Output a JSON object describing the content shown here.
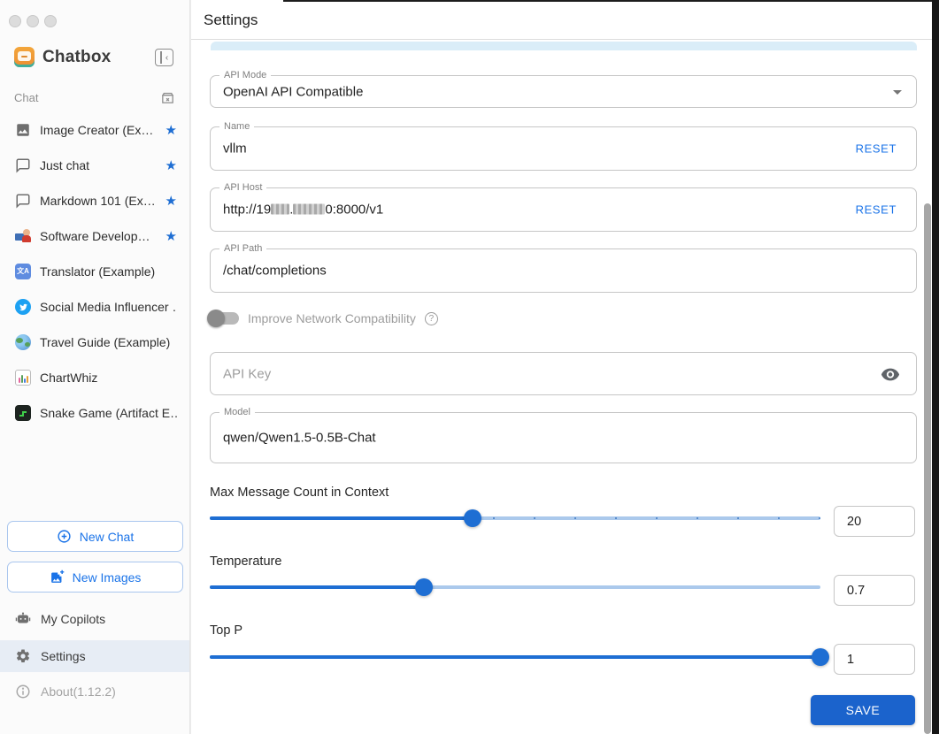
{
  "colors": {
    "accent_blue": "#1e6ed3",
    "link_blue": "#1a73e8",
    "save_button_bg": "#1b63cc",
    "slider_inactive": "#abc9ec",
    "selected_row_bg": "#e7edf5",
    "scroll_hint_bg": "#daedf8"
  },
  "sidebar": {
    "app_name": "Chatbox",
    "section_label": "Chat",
    "items": [
      {
        "label": "Image Creator (Ex…",
        "icon": "image-icon",
        "starred": true
      },
      {
        "label": "Just chat",
        "icon": "chat-bubble-icon",
        "starred": true
      },
      {
        "label": "Markdown 101 (Ex…",
        "icon": "chat-bubble-icon",
        "starred": true
      },
      {
        "label": "Software Develop…",
        "icon": "developer-emoji-icon",
        "starred": true
      },
      {
        "label": "Translator (Example)",
        "icon": "translator-emoji-icon",
        "starred": false
      },
      {
        "label": "Social Media Influencer …",
        "icon": "twitter-bird-icon",
        "starred": false
      },
      {
        "label": "Travel Guide (Example)",
        "icon": "globe-emoji-icon",
        "starred": false
      },
      {
        "label": "ChartWhiz",
        "icon": "chart-emoji-icon",
        "starred": false
      },
      {
        "label": "Snake Game (Artifact E…",
        "icon": "snake-game-icon",
        "starred": false
      }
    ],
    "new_chat_label": "New Chat",
    "new_images_label": "New Images",
    "nav": [
      {
        "label": "My Copilots",
        "icon": "robot-icon",
        "selected": false
      },
      {
        "label": "Settings",
        "icon": "gear-icon",
        "selected": true
      },
      {
        "label": "About(1.12.2)",
        "icon": "info-icon",
        "selected": false
      }
    ]
  },
  "header": {
    "title": "Settings"
  },
  "form": {
    "api_mode": {
      "label": "API Mode",
      "value": "OpenAI API Compatible"
    },
    "name": {
      "label": "Name",
      "value": "vllm",
      "action": "RESET"
    },
    "api_host": {
      "label": "API Host",
      "value_prefix": "http://19",
      "value_mid": ".",
      "value_suffix": "0:8000/v1",
      "action": "RESET"
    },
    "api_path": {
      "label": "API Path",
      "value": "/chat/completions"
    },
    "network_toggle": {
      "label": "Improve Network Compatibility",
      "state": "off"
    },
    "api_key": {
      "placeholder": "API Key"
    },
    "model": {
      "label": "Model",
      "value": "qwen/Qwen1.5-0.5B-Chat"
    },
    "sliders": [
      {
        "label": "Max Message Count in Context",
        "value": "20",
        "percent": 43,
        "ticks": true
      },
      {
        "label": "Temperature",
        "value": "0.7",
        "percent": 35,
        "ticks": false
      },
      {
        "label": "Top P",
        "value": "1",
        "percent": 100,
        "ticks": false
      }
    ],
    "save_label": "SAVE"
  }
}
